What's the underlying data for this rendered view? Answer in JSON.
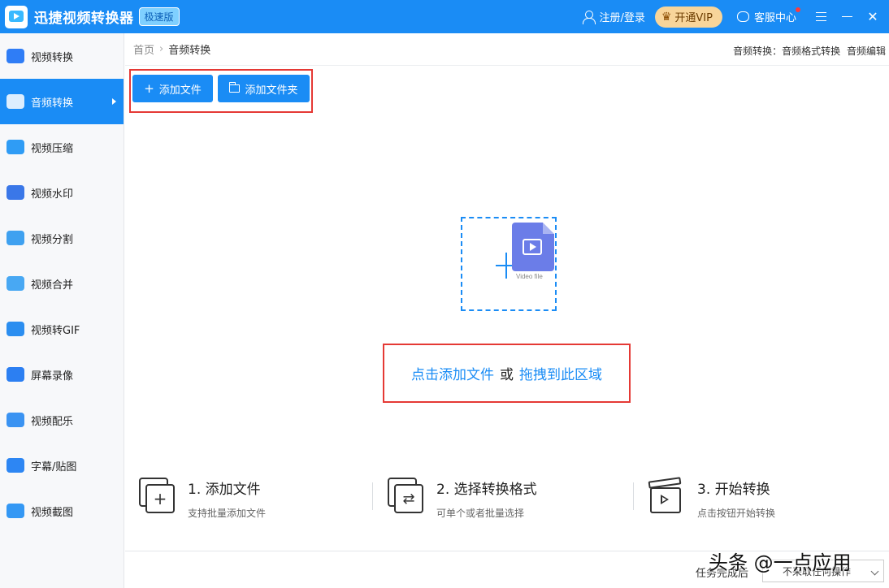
{
  "titlebar": {
    "app_name": "迅捷视频转换器",
    "edition": "极速版",
    "login": "注册/登录",
    "vip": "开通VIP",
    "service": "客服中心"
  },
  "sidebar": {
    "items": [
      {
        "label": "视频转换",
        "icon": "video-convert-icon",
        "color": "#2f7df6"
      },
      {
        "label": "音频转换",
        "icon": "audio-convert-icon",
        "color": "#ffffff",
        "active": true
      },
      {
        "label": "视频压缩",
        "icon": "video-compress-icon",
        "color": "#2f9cf5"
      },
      {
        "label": "视频水印",
        "icon": "video-watermark-icon",
        "color": "#3a77e8"
      },
      {
        "label": "视频分割",
        "icon": "video-split-icon",
        "color": "#3fa1f0"
      },
      {
        "label": "视频合并",
        "icon": "video-merge-icon",
        "color": "#48a8f3"
      },
      {
        "label": "视频转GIF",
        "icon": "video-gif-icon",
        "color": "#2b8ef0"
      },
      {
        "label": "屏幕录像",
        "icon": "screen-record-icon",
        "color": "#2c7ff2"
      },
      {
        "label": "视频配乐",
        "icon": "video-music-icon",
        "color": "#3a93f2"
      },
      {
        "label": "字幕/贴图",
        "icon": "subtitle-sticker-icon",
        "color": "#2d86f3"
      },
      {
        "label": "视频截图",
        "icon": "video-screenshot-icon",
        "color": "#3498f4"
      }
    ]
  },
  "breadcrumb": {
    "home": "首页",
    "current": "音频转换",
    "right_label": "音频转换：",
    "right_link1": "音频格式转换",
    "right_link2": "音频编辑"
  },
  "toolbar": {
    "add_file": "添加文件",
    "add_folder": "添加文件夹"
  },
  "dropzone": {
    "file_label": "Video file",
    "click_text": "点击添加文件",
    "or_text": "或",
    "drag_text": "拖拽到此区域"
  },
  "steps": [
    {
      "title": "1. 添加文件",
      "subtitle": "支持批量添加文件"
    },
    {
      "title": "2. 选择转换格式",
      "subtitle": "可单个或者批量选择"
    },
    {
      "title": "3. 开始转换",
      "subtitle": "点击按钮开始转换"
    }
  ],
  "bottom": {
    "after_label": "任务完成后",
    "select_value": "不采取任何操作",
    "watermark": "头条 @一点应用"
  },
  "colors": {
    "accent": "#1a8cf5",
    "highlight_border": "#e53935",
    "vip_bg": "#f8d59a"
  }
}
